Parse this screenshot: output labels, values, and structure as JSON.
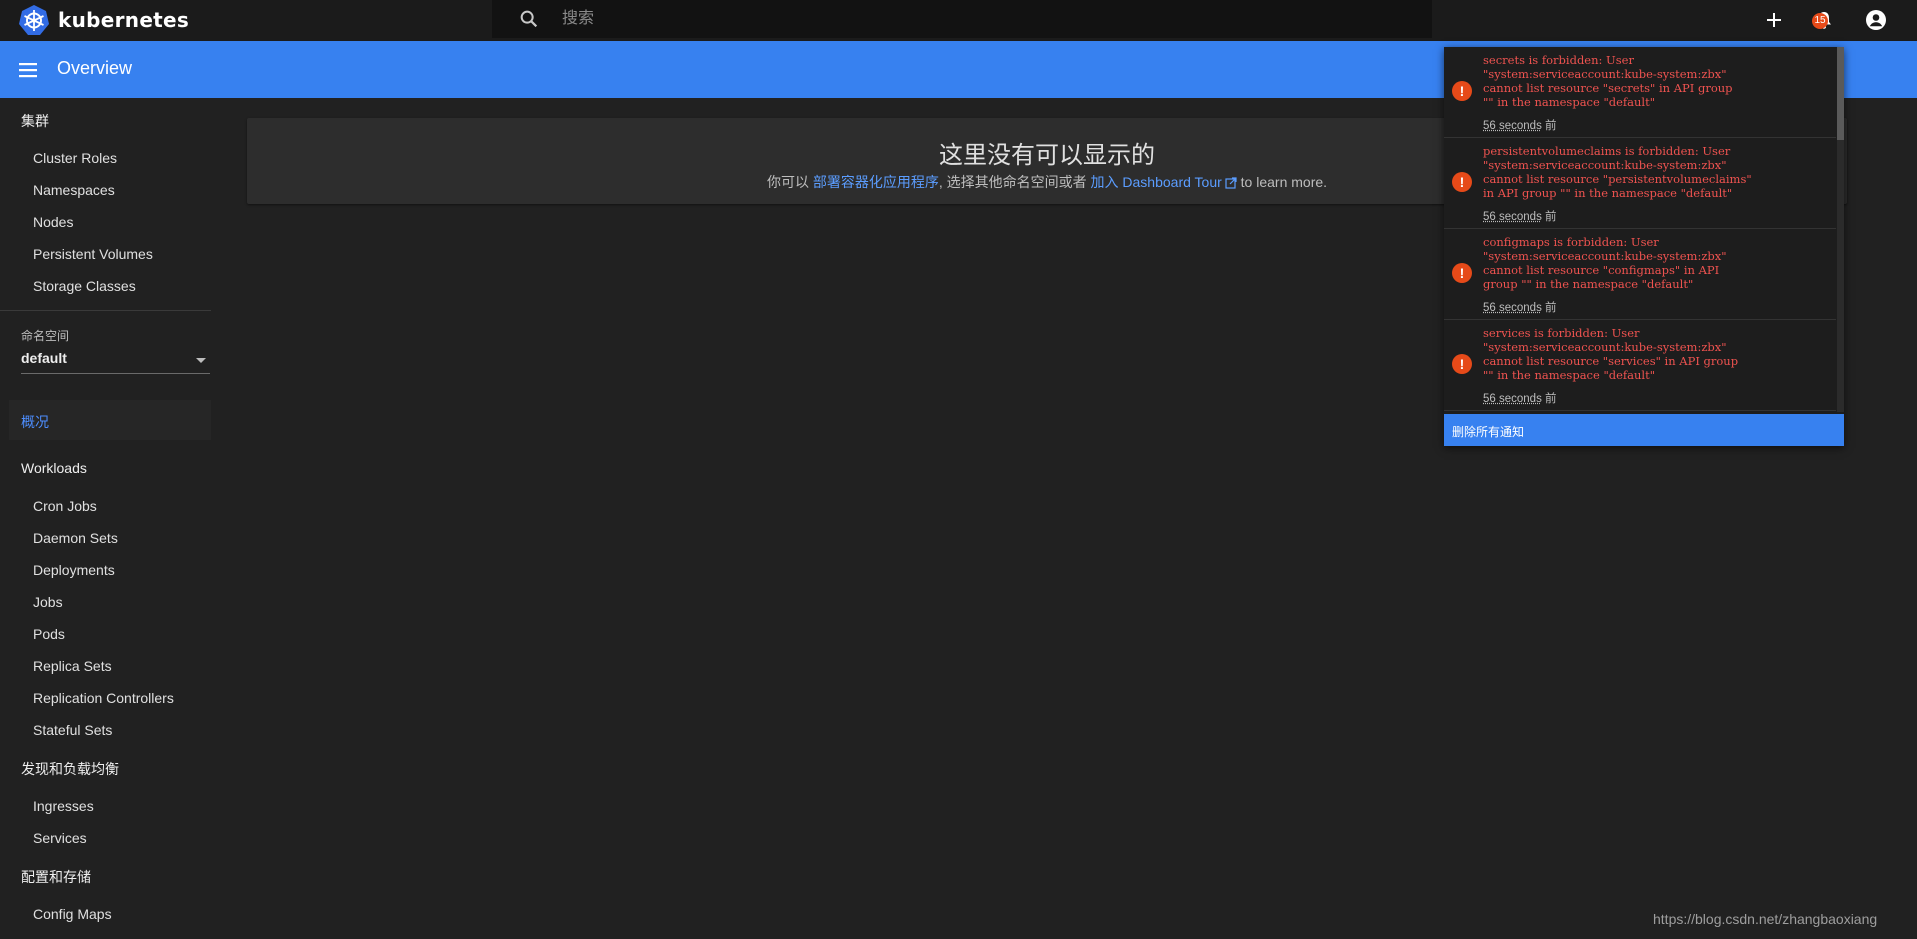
{
  "app": {
    "name": "kubernetes"
  },
  "search": {
    "placeholder": "搜索"
  },
  "notifications_badge": "15",
  "header": {
    "title": "Overview"
  },
  "sidebar": {
    "cluster_section": "集群",
    "cluster_items": [
      "Cluster Roles",
      "Namespaces",
      "Nodes",
      "Persistent Volumes",
      "Storage Classes"
    ],
    "namespace_label": "命名空间",
    "namespace_value": "default",
    "overview_label": "概况",
    "workloads_section": "Workloads",
    "workloads_items": [
      "Cron Jobs",
      "Daemon Sets",
      "Deployments",
      "Jobs",
      "Pods",
      "Replica Sets",
      "Replication Controllers",
      "Stateful Sets"
    ],
    "discovery_section": "发现和负载均衡",
    "discovery_items": [
      "Ingresses",
      "Services"
    ],
    "config_section": "配置和存储",
    "config_items": [
      "Config Maps"
    ]
  },
  "empty_state": {
    "title": "这里没有可以显示的",
    "prefix": "你可以",
    "deploy_link": "部署容器化应用程序",
    "middle": ", 选择其他命名空间或者",
    "tour_link": "加入 Dashboard Tour",
    "suffix": "to learn more."
  },
  "notifications": [
    {
      "message": "secrets is forbidden: User\n\"system:serviceaccount:kube-system:zbx\"\ncannot list resource \"secrets\" in API group\n\"\" in the namespace \"default\"",
      "time": "56 seconds",
      "time_suffix": "前"
    },
    {
      "message": "persistentvolumeclaims is forbidden: User\n\"system:serviceaccount:kube-system:zbx\"\ncannot list resource \"persistentvolumeclaims\"\nin API group \"\" in the namespace \"default\"",
      "time": "56 seconds",
      "time_suffix": "前"
    },
    {
      "message": "configmaps is forbidden: User\n\"system:serviceaccount:kube-system:zbx\"\ncannot list resource \"configmaps\" in API\ngroup \"\" in the namespace \"default\"",
      "time": "56 seconds",
      "time_suffix": "前"
    },
    {
      "message": "services is forbidden: User\n\"system:serviceaccount:kube-system:zbx\"\ncannot list resource \"services\" in API group\n\"\" in the namespace \"default\"",
      "time": "56 seconds",
      "time_suffix": "前"
    }
  ],
  "clear_all_label": "删除所有通知",
  "watermark": "https://blog.csdn.net/zhangbaoxiang",
  "colors": {
    "accent": "#3781f0",
    "error": "#ef5350",
    "badge": "#e64a19",
    "link": "#5b9dff",
    "background": "#212121"
  },
  "icons": [
    "kubernetes-logo-icon",
    "search-icon",
    "plus-icon",
    "bell-icon",
    "account-icon",
    "menu-icon",
    "error-icon",
    "external-link-icon"
  ]
}
